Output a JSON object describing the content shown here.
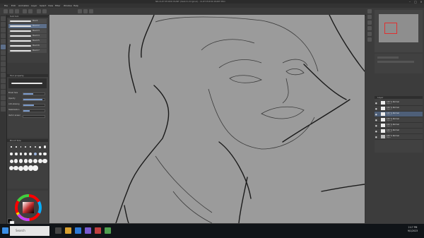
{
  "window": {
    "title": "NR-CLIP STUDIO PAINT (Sketch-Original) - CLIP STUDIO PAINT PRO",
    "controls": [
      "minimize-icon",
      "maximize-icon",
      "close-icon"
    ]
  },
  "menu": {
    "items": [
      "File",
      "Edit",
      "Animation",
      "Layer",
      "Select",
      "View",
      "Filter",
      "Window",
      "Help"
    ]
  },
  "subtool": {
    "header": "Sub tool",
    "brushes": [
      "Pencil",
      "Pencil 2",
      "Pencil 3",
      "Pencil 4",
      "Pencil 5",
      "Pencil 6",
      "Pencil 7"
    ]
  },
  "toolprop": {
    "header": "Tool property",
    "rows": [
      {
        "label": "Brush Size",
        "value": 0.45
      },
      {
        "label": "Opacity",
        "value": 0.9
      },
      {
        "label": "Anti-aliasing",
        "value": 0.5
      },
      {
        "label": "Stabilization",
        "value": 0.3
      },
      {
        "label": "Vector eraser",
        "value": 0.0
      }
    ]
  },
  "brushsize": {
    "header": "Brush Size"
  },
  "colors": {
    "main": "#000000",
    "sub": "#ffffff",
    "wheel_center": "#c33030"
  },
  "layers": {
    "header": "Layer",
    "rows": [
      {
        "name": "100 % Normal",
        "sub": "Layer 1",
        "selected": false
      },
      {
        "name": "100 % Normal",
        "sub": "Layer 2",
        "selected": false
      },
      {
        "name": "100 % Normal",
        "sub": "Layer 3",
        "selected": true
      },
      {
        "name": "100 % Normal",
        "sub": "Layer 4",
        "selected": false
      },
      {
        "name": "100 % Normal",
        "sub": "Layer 5",
        "selected": false
      },
      {
        "name": "100 % Normal",
        "sub": "Layer 6",
        "selected": false
      },
      {
        "name": "100 % Normal",
        "sub": "Paper",
        "selected": false
      }
    ]
  },
  "taskbar": {
    "search_placeholder": "Search",
    "time": "2:17 PM",
    "date": "9/1/2023"
  }
}
